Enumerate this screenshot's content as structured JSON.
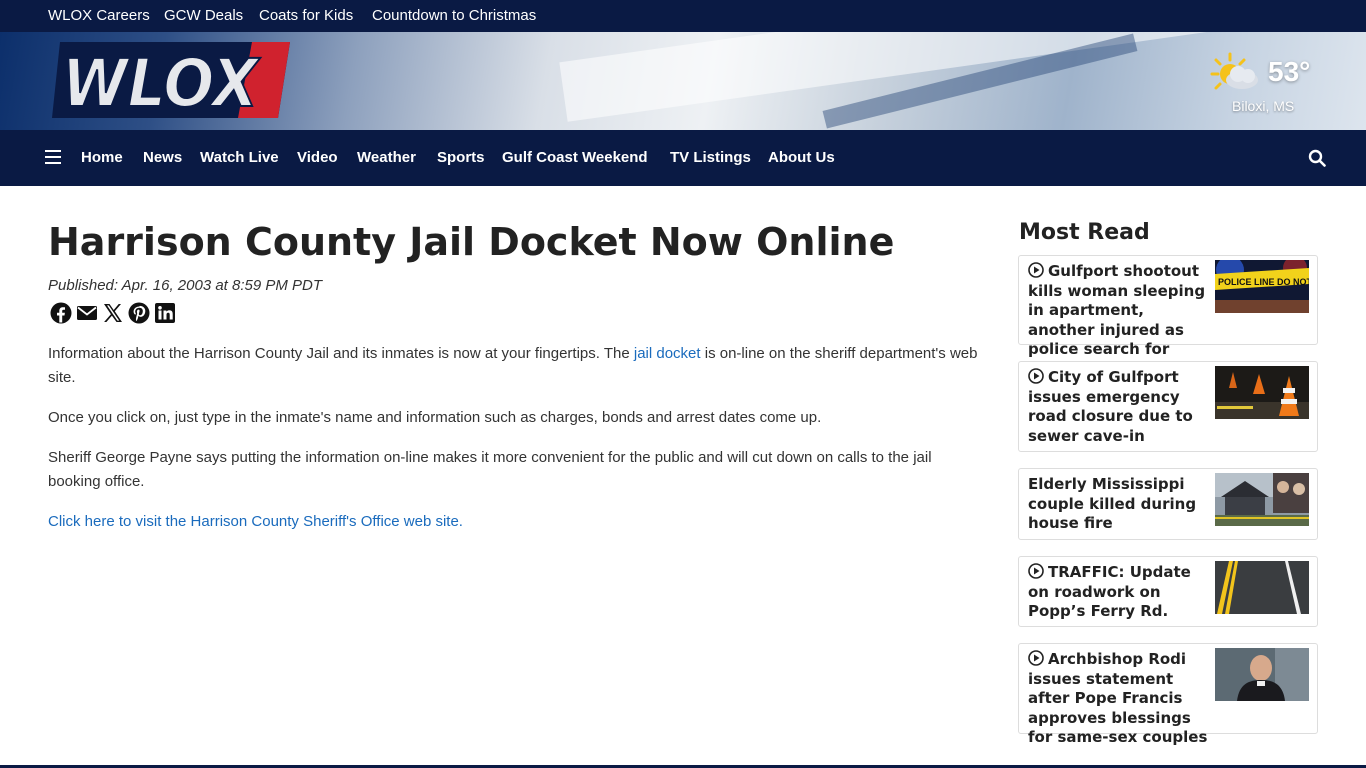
{
  "topbar": {
    "links": [
      "WLOX Careers",
      "GCW Deals",
      "Coats for Kids",
      "Countdown to Christmas"
    ]
  },
  "banner": {
    "logo_text": "WLOX",
    "weather": {
      "temp": "53°",
      "location": "Biloxi, MS",
      "icon": "partly-sunny-icon"
    }
  },
  "nav": {
    "items": [
      "Home",
      "News",
      "Watch Live",
      "Video",
      "Weather",
      "Sports",
      "Gulf Coast Weekend",
      "TV Listings",
      "About Us"
    ],
    "menu_icon": "hamburger-menu-icon",
    "search_icon": "search-icon"
  },
  "article": {
    "headline": "Harrison County Jail Docket Now Online",
    "published": "Published: Apr. 16, 2003 at 8:59 PM PDT",
    "share_icons": [
      "facebook-icon",
      "email-icon",
      "x-icon",
      "pinterest-icon",
      "linkedin-icon"
    ],
    "p1_before": "Information about the Harrison County Jail and its inmates is now at your fingertips. The ",
    "p1_link": "jail docket",
    "p1_after": " is on-line on the sheriff department's web site.",
    "p2": "Once you click on, just type in the inmate's name and information such as charges, bonds and arrest dates come up.",
    "p3": "Sheriff George Payne says putting the information on-line makes it more convenient for the public and will cut down on calls to the jail booking office.",
    "link_text": "Click here to visit the Harrison County Sheriff's Office web site."
  },
  "most_read": {
    "title": "Most Read",
    "items": [
      {
        "title": "Gulfport shootout kills woman sleeping in apartment, another injured as police search for suspects",
        "video": true
      },
      {
        "title": "City of Gulfport issues emergency road closure due to sewer cave-in",
        "video": true
      },
      {
        "title": "Elderly Mississippi couple killed during house fire",
        "video": false
      },
      {
        "title": "TRAFFIC: Update on roadwork on Popp’s Ferry Rd.",
        "video": true
      },
      {
        "title": "Archbishop Rodi issues statement after Pope Francis approves blessings for same-sex couples",
        "video": true
      }
    ],
    "thumb_text": "POLICE LINE DO NOT CROSS"
  },
  "colors": {
    "navy": "#0a1a44",
    "link": "#1a6bbd",
    "logo_red": "#d0222e"
  }
}
